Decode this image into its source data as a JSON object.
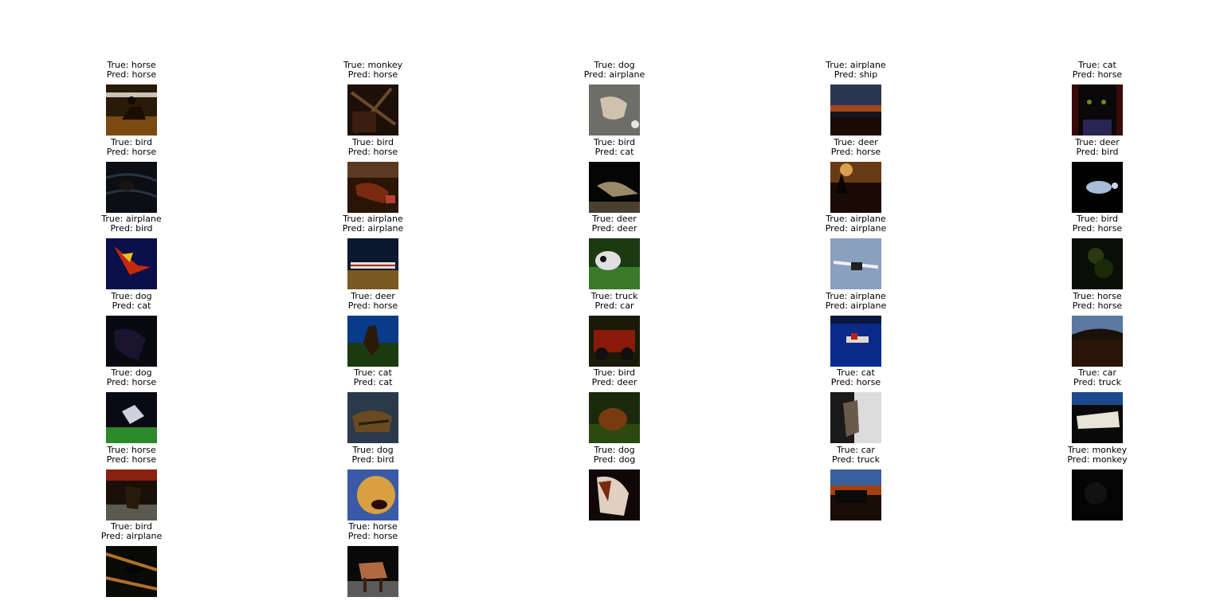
{
  "panels": [
    {
      "true_label": "True: horse",
      "pred_label": "Pred: horse",
      "scene": "rider on horse in dirt arena"
    },
    {
      "true_label": "True: monkey",
      "pred_label": "Pred: horse",
      "scene": "dark branches"
    },
    {
      "true_label": "True: dog",
      "pred_label": "Pred: airplane",
      "scene": "dog running in snow"
    },
    {
      "true_label": "True: airplane",
      "pred_label": "Pred: ship",
      "scene": "dusk sky over dark ground"
    },
    {
      "true_label": "True: cat",
      "pred_label": "Pred: horse",
      "scene": "black cat portrait"
    },
    {
      "true_label": "True: bird",
      "pred_label": "Pred: horse",
      "scene": "dark water with bird"
    },
    {
      "true_label": "True: bird",
      "pred_label": "Pred: horse",
      "scene": "red bird near cage"
    },
    {
      "true_label": "True: bird",
      "pred_label": "Pred: cat",
      "scene": "bird on ledge"
    },
    {
      "true_label": "True: deer",
      "pred_label": "Pred: horse",
      "scene": "deer silhouette at sunset"
    },
    {
      "true_label": "True: deer",
      "pred_label": "Pred: bird",
      "scene": "pale animal on black"
    },
    {
      "true_label": "True: airplane",
      "pred_label": "Pred: bird",
      "scene": "red aircraft on navy"
    },
    {
      "true_label": "True: airplane",
      "pred_label": "Pred: airplane",
      "scene": "airliner on runway"
    },
    {
      "true_label": "True: deer",
      "pred_label": "Pred: deer",
      "scene": "spotted animal in grass"
    },
    {
      "true_label": "True: airplane",
      "pred_label": "Pred: airplane",
      "scene": "seaplane in blue sky"
    },
    {
      "true_label": "True: bird",
      "pred_label": "Pred: horse",
      "scene": "dark foliage"
    },
    {
      "true_label": "True: dog",
      "pred_label": "Pred: cat",
      "scene": "dark dog"
    },
    {
      "true_label": "True: deer",
      "pred_label": "Pred: horse",
      "scene": "deer against sky"
    },
    {
      "true_label": "True: truck",
      "pred_label": "Pred: car",
      "scene": "red vintage truck"
    },
    {
      "true_label": "True: airplane",
      "pred_label": "Pred: airplane",
      "scene": "seaplane on water"
    },
    {
      "true_label": "True: horse",
      "pred_label": "Pred: horse",
      "scene": "horse in dusk field"
    },
    {
      "true_label": "True: dog",
      "pred_label": "Pred: horse",
      "scene": "dog on grass"
    },
    {
      "true_label": "True: cat",
      "pred_label": "Pred: cat",
      "scene": "tabby cat walking"
    },
    {
      "true_label": "True: bird",
      "pred_label": "Pred: deer",
      "scene": "brown dog on grass"
    },
    {
      "true_label": "True: cat",
      "pred_label": "Pred: horse",
      "scene": "cat by window"
    },
    {
      "true_label": "True: car",
      "pred_label": "Pred: truck",
      "scene": "white limousine"
    },
    {
      "true_label": "True: horse",
      "pred_label": "Pred: horse",
      "scene": "horse under awning"
    },
    {
      "true_label": "True: dog",
      "pred_label": "Pred: bird",
      "scene": "golden dog face"
    },
    {
      "true_label": "True: dog",
      "pred_label": "Pred: dog",
      "scene": "beagle"
    },
    {
      "true_label": "True: car",
      "pred_label": "Pred: truck",
      "scene": "car at sunset"
    },
    {
      "true_label": "True: monkey",
      "pred_label": "Pred: monkey",
      "scene": "dark monkey"
    },
    {
      "true_label": "True: bird",
      "pred_label": "Pred: airplane",
      "scene": "black bird on branch"
    },
    {
      "true_label": "True: horse",
      "pred_label": "Pred: horse",
      "scene": "brown pony on road"
    }
  ]
}
